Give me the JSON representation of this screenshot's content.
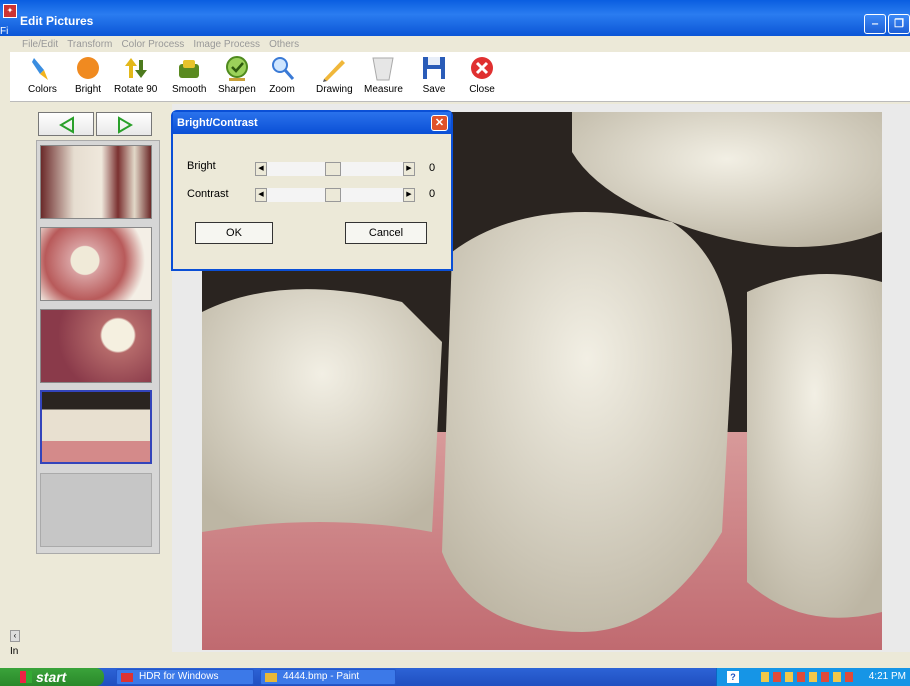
{
  "window": {
    "title": "Edit Pictures",
    "app_icon": "app-icon",
    "side_fragment": "Fi"
  },
  "menu": [
    "File/Edit",
    "Transform",
    "Color Process",
    "Image Process",
    "Others"
  ],
  "toolbar": [
    {
      "label": "Colors",
      "icon": "brush-icon"
    },
    {
      "label": "Bright",
      "icon": "orange-circle-icon"
    },
    {
      "label": "Rotate 90",
      "icon": "rotate-arrows-icon"
    },
    {
      "label": "Smooth",
      "icon": "smooth-icon"
    },
    {
      "label": "Sharpen",
      "icon": "sharpen-check-icon"
    },
    {
      "label": "Zoom",
      "icon": "magnifier-icon"
    },
    {
      "label": "Drawing",
      "icon": "pencil-icon"
    },
    {
      "label": "Measure",
      "icon": "measure-icon"
    },
    {
      "label": "Save",
      "icon": "floppy-icon"
    },
    {
      "label": "Close",
      "icon": "close-red-icon"
    }
  ],
  "dialog": {
    "title": "Bright/Contrast",
    "bright_label": "Bright",
    "bright_value": "0",
    "contrast_label": "Contrast",
    "contrast_value": "0",
    "ok_label": "OK",
    "cancel_label": "Cancel"
  },
  "left_status": "In",
  "taskbar": {
    "start_label": "start",
    "tasks": [
      "HDR for Windows",
      "4444.bmp - Paint"
    ],
    "clock": "4:21 PM"
  },
  "colors": {
    "title_blue": "#0a5ee0",
    "taskbar_blue": "#2d63d6",
    "start_green": "#3aa33a",
    "selection": "#3344bb"
  }
}
